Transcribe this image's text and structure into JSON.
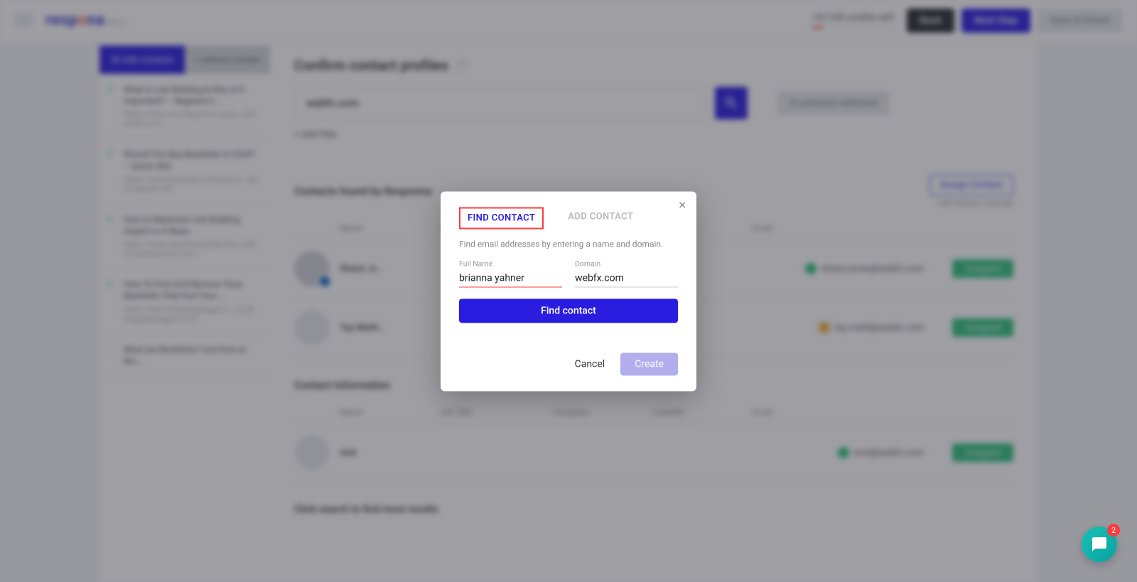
{
  "topbar": {
    "logo_text": "respona",
    "logo_beta": "BETA",
    "credits_text": "10/100 credits left",
    "back_label": "Back",
    "next_label": "Next Step",
    "finish_label": "Save & Finish"
  },
  "sidepane": {
    "tab_with": "20 with contacts",
    "tab_without": "1 without contact",
    "items": [
      {
        "title": "What is Link Building & Why is It Important? – Beginner's …",
        "url": "https://moz.com/beginners-guid…whiteness.com"
      },
      {
        "title": "Should You Buy Backlinks in 2020? – Gotch SEO",
        "url": "https://www.gotchseo.com/buy-b…radiomaginfo.net"
      },
      {
        "title": "How to Maximize Link Building Impact in 4 Steps",
        "url": "https://www.searchenginejourna…searchenginejournal.com"
      },
      {
        "title": "How To Find And Remove Toxic Backlinks That Hurt Your …",
        "url": "https://www.bloggingtriggers.c…am@bloggingtriggers.com"
      },
      {
        "title": "What are Backlinks? And How to Bui…",
        "url": ""
      }
    ]
  },
  "main": {
    "page_title": "Confirm contact profiles",
    "search_value": "webfx.com",
    "contacts_selected_label": "0 contacts selected",
    "add_filter": "+ Add Filter",
    "section1_title": "Contacts found by Responna",
    "assign_btn": "Assign Contact",
    "assign_manual": "Add contact manually",
    "columns": {
      "name": "Name",
      "job": "Job Title",
      "company": "Company",
      "linkedin": "LinkedIn",
      "email": "Email"
    },
    "rows": [
      {
        "name": "Shane Jr…",
        "email": "shane.jones@webfx.com",
        "status": "green",
        "assigned": "Assigned"
      },
      {
        "name": "Tay Mattl…",
        "email": "tay.mattl@webfx.com",
        "status": "amber",
        "assigned": "Assigned"
      }
    ],
    "section2_title": "Contact Information",
    "rows2": [
      {
        "name": "nick",
        "email": "nick@webfx.com",
        "status": "green",
        "assigned": "Assigned"
      }
    ],
    "footer_hint": "Click search to find more results"
  },
  "modal": {
    "tab_find": "FIND CONTACT",
    "tab_add": "ADD CONTACT",
    "description": "Find email addresses by entering a name and domain.",
    "full_name_label": "Full Name",
    "full_name_value": "brianna yahner",
    "domain_label": "Domain",
    "domain_value": "webfx.com",
    "find_button": "Find contact",
    "cancel": "Cancel",
    "create": "Create"
  },
  "fab": {
    "count": "2"
  }
}
